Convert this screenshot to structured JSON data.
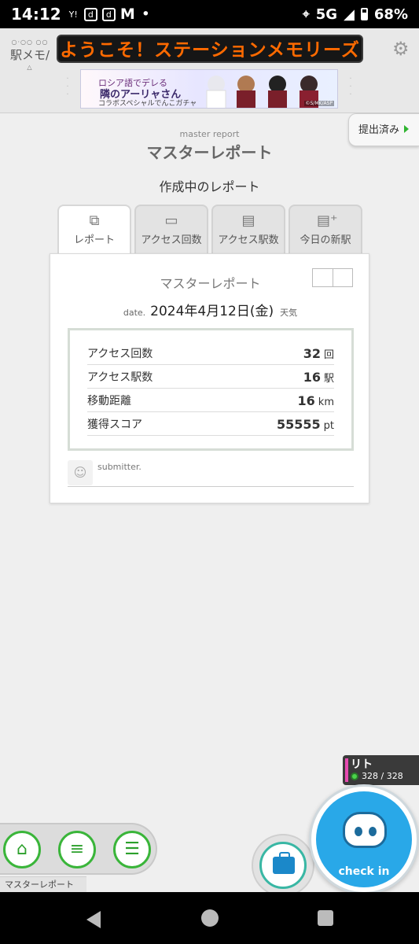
{
  "status_bar": {
    "time": "14:12",
    "notif_icons": [
      "Y!",
      "d",
      "d",
      "M"
    ],
    "dot": "•",
    "network": "5G",
    "battery": "68%"
  },
  "header": {
    "logo_top": "○·○○ ○○",
    "logo_text": "駅メモ/",
    "logo_sub": "△",
    "marquee_text": "ようこそ！ステーションメモリーズ",
    "banner": {
      "kicker": "",
      "line1": "ロシア語でデレる",
      "line2": "隣のアーリャさん",
      "line3": "コラボスペシャルでんこガチャ",
      "copyright": "©S/MK/ASP"
    }
  },
  "submitted_button": {
    "label": "提出済み"
  },
  "page": {
    "title_en": "master report",
    "title_jp": "マスターレポート",
    "subheading": "作成中のレポート"
  },
  "tabs": [
    {
      "label": "レポート",
      "icon": "report-icon",
      "active": true
    },
    {
      "label": "アクセス回数",
      "icon": "card-icon",
      "active": false
    },
    {
      "label": "アクセス駅数",
      "icon": "train-icon",
      "active": false
    },
    {
      "label": "今日の新駅",
      "icon": "new-train-icon",
      "active": false
    }
  ],
  "report": {
    "title": "マスターレポート",
    "date_label": "date.",
    "date": "2024年4月12日(金)",
    "weather_label": "天気",
    "stats": [
      {
        "label": "アクセス回数",
        "value": "32",
        "unit": "回"
      },
      {
        "label": "アクセス駅数",
        "value": "16",
        "unit": "駅"
      },
      {
        "label": "移動距離",
        "value": "16",
        "unit": "km"
      },
      {
        "label": "獲得スコア",
        "value": "55555",
        "unit": "pt"
      }
    ],
    "submitter_label": "submitter."
  },
  "character": {
    "name": "リト",
    "hp": "328 / 328",
    "accent": "#e64ab0"
  },
  "checkin": {
    "label": "check in"
  },
  "bottom_nav": {
    "current_label": "マスターレポート",
    "buttons": [
      "home-icon",
      "list-icon",
      "report-list-icon"
    ]
  },
  "colors": {
    "marquee": "#ff6a00",
    "green": "#3ab53a",
    "checkin_blue": "#29a8e8"
  }
}
